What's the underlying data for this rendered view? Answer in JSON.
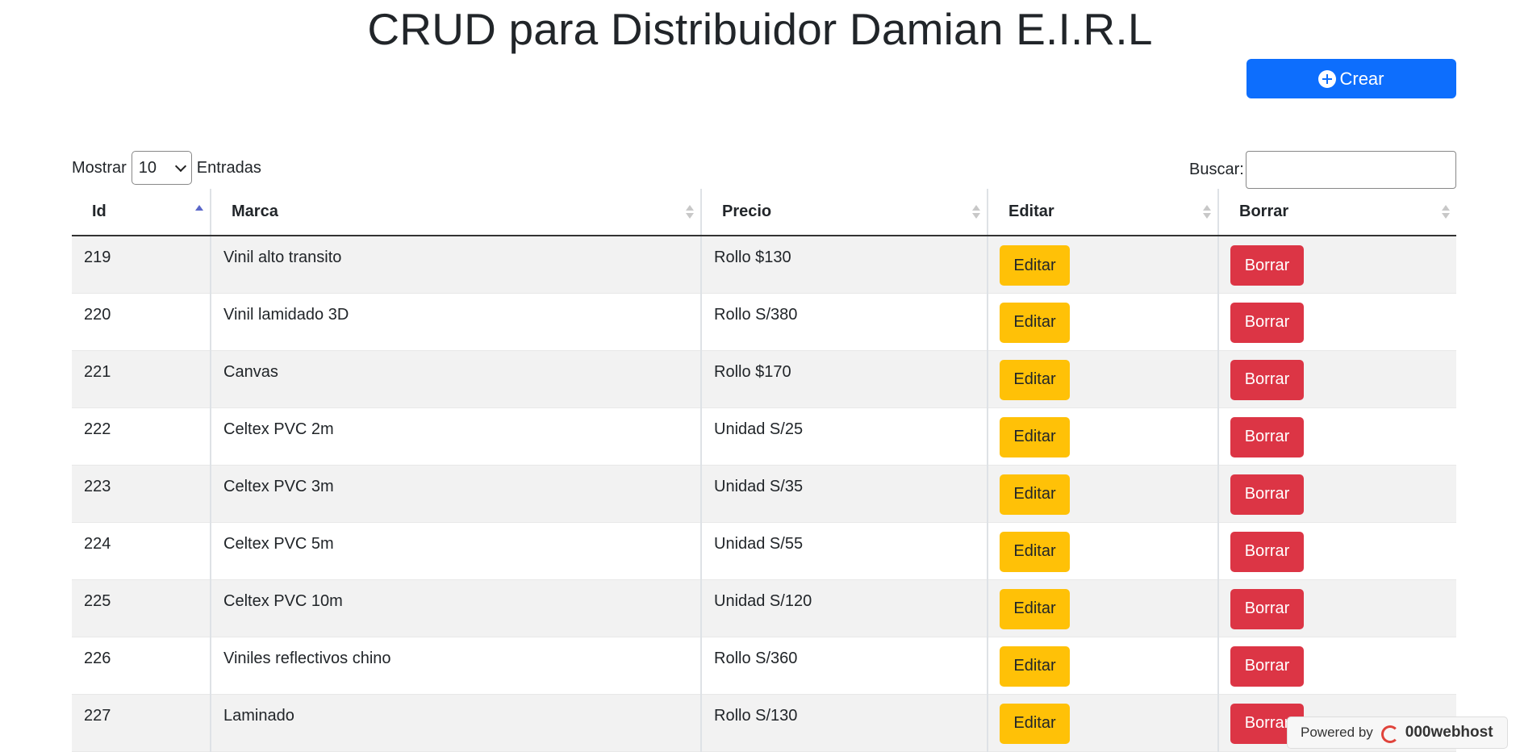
{
  "header": {
    "title": "CRUD para Distribuidor Damian E.I.R.L",
    "create_label": "Crear"
  },
  "controls": {
    "show_label": "Mostrar",
    "entries_value": "10",
    "entries_label": "Entradas",
    "search_label": "Buscar:",
    "search_value": ""
  },
  "table": {
    "columns": [
      "Id",
      "Marca",
      "Precio",
      "Editar",
      "Borrar"
    ],
    "rows": [
      {
        "id": "219",
        "marca": "Vinil alto transito",
        "precio": "Rollo $130"
      },
      {
        "id": "220",
        "marca": "Vinil lamidado 3D",
        "precio": "Rollo S/380"
      },
      {
        "id": "221",
        "marca": "Canvas",
        "precio": "Rollo $170"
      },
      {
        "id": "222",
        "marca": "Celtex PVC 2m",
        "precio": "Unidad S/25"
      },
      {
        "id": "223",
        "marca": "Celtex PVC 3m",
        "precio": "Unidad S/35"
      },
      {
        "id": "224",
        "marca": "Celtex PVC 5m",
        "precio": "Unidad S/55"
      },
      {
        "id": "225",
        "marca": "Celtex PVC 10m",
        "precio": "Unidad S/120"
      },
      {
        "id": "226",
        "marca": "Viniles reflectivos chino",
        "precio": "Rollo S/360"
      },
      {
        "id": "227",
        "marca": "Laminado",
        "precio": "Rollo S/130"
      }
    ],
    "edit_label": "Editar",
    "delete_label": "Borrar"
  },
  "badge": {
    "powered_text": "Powered by",
    "brand": "000webhost"
  },
  "colors": {
    "primary": "#0d6efd",
    "warning": "#ffc107",
    "danger": "#dc3545",
    "sort_active": "#5a67c9"
  }
}
